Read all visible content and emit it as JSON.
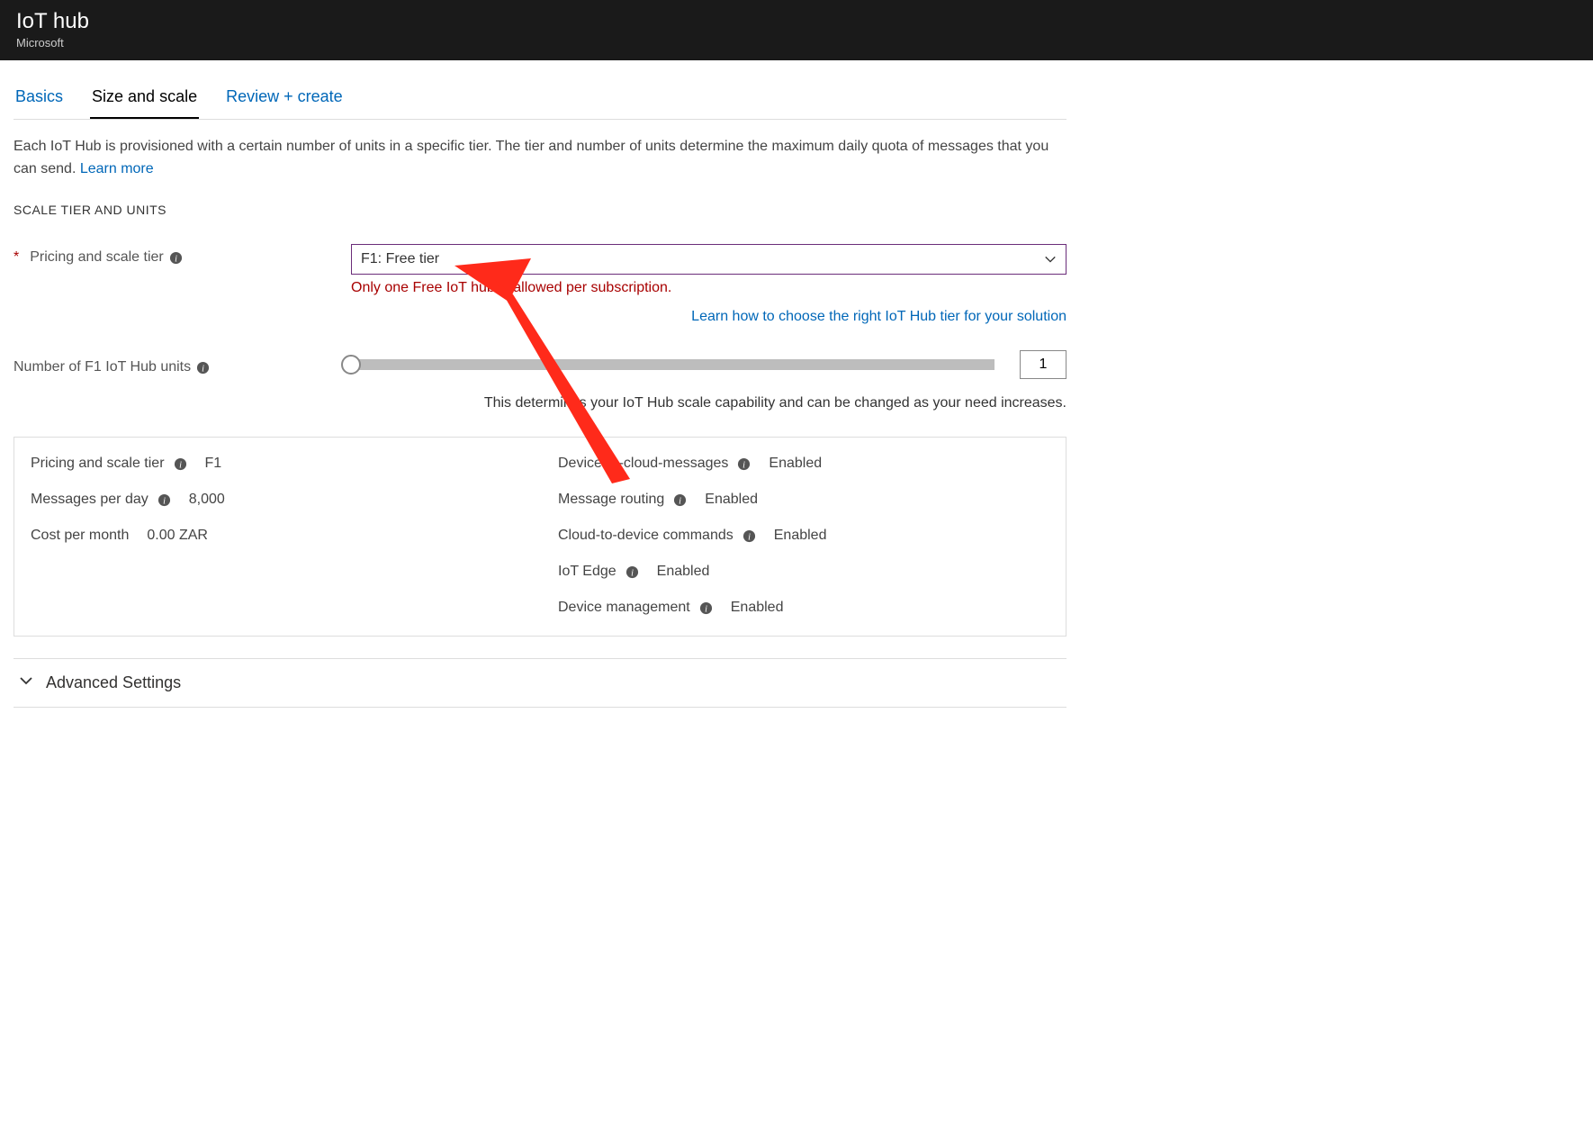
{
  "header": {
    "title": "IoT hub",
    "subtitle": "Microsoft"
  },
  "tabs": [
    {
      "label": "Basics",
      "active": false
    },
    {
      "label": "Size and scale",
      "active": true
    },
    {
      "label": "Review + create",
      "active": false
    }
  ],
  "intro": {
    "text": "Each IoT Hub is provisioned with a certain number of units in a specific tier. The tier and number of units determine the maximum daily quota of messages that you can send. ",
    "learn_more": "Learn more"
  },
  "section_heading": "SCALE TIER AND UNITS",
  "tier": {
    "label": "Pricing and scale tier",
    "value": "F1: Free tier",
    "warning": "Only one Free IoT hub is allowed per subscription.",
    "choose_link": "Learn how to choose the right IoT Hub tier for your solution"
  },
  "units": {
    "label": "Number of F1 IoT Hub units",
    "value": "1",
    "help": "This determines your IoT Hub scale capability and can be changed as your need increases."
  },
  "details": {
    "left": [
      {
        "label": "Pricing and scale tier",
        "icon": true,
        "value": "F1"
      },
      {
        "label": "Messages per day",
        "icon": true,
        "value": "8,000"
      },
      {
        "label": "Cost per month",
        "icon": false,
        "value": "0.00 ZAR"
      }
    ],
    "right": [
      {
        "label": "Device-to-cloud-messages",
        "value": "Enabled"
      },
      {
        "label": "Message routing",
        "value": "Enabled"
      },
      {
        "label": "Cloud-to-device commands",
        "value": "Enabled"
      },
      {
        "label": "IoT Edge",
        "value": "Enabled"
      },
      {
        "label": "Device management",
        "value": "Enabled"
      }
    ]
  },
  "advanced_label": "Advanced Settings"
}
